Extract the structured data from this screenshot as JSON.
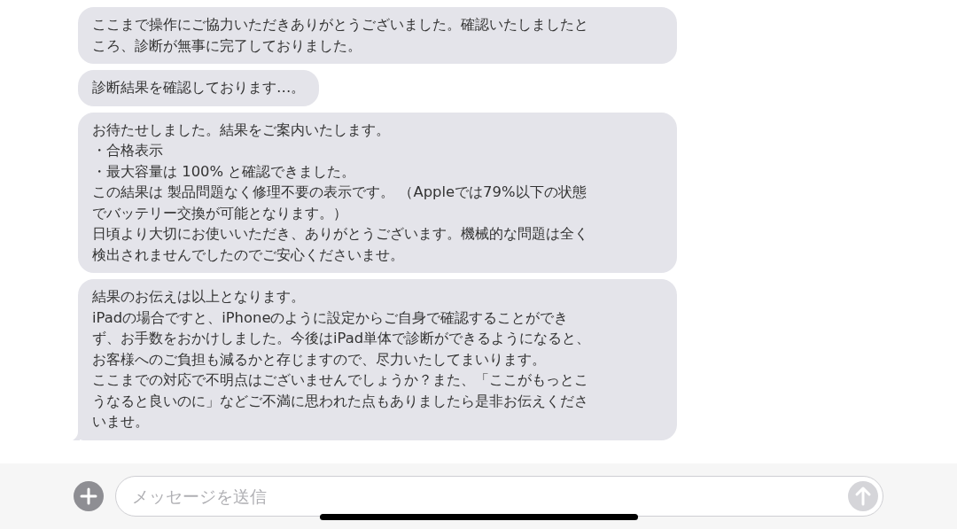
{
  "messages": [
    {
      "lines": [
        "ここまで操作にご協力いただきありがとうございました。確認いたしましたと",
        "ころ、診断が無事に完了しておりました。"
      ],
      "tail": false
    },
    {
      "lines": [
        "診断結果を確認しております…。"
      ],
      "tail": false
    },
    {
      "lines": [
        "お待たせしました。結果をご案内いたします。",
        "・合格表示",
        "・最大容量は 100% と確認できました。",
        "この結果は 製品問題なく修理不要の表示です。 （Appleでは79%以下の状態",
        "でバッテリー交換が可能となります。）",
        "日頃より大切にお使いいただき、ありがとうございます。機械的な問題は全く",
        "検出されませんでしたのでご安心くださいませ。"
      ],
      "tail": false
    },
    {
      "lines": [
        "結果のお伝えは以上となります。",
        "iPadの場合ですと、iPhoneのように設定からご自身で確認することができ",
        "ず、お手数をおかけしました。今後はiPad単体で診断ができるようになると、",
        "お客様へのご負担も減るかと存じますので、尽力いたしてまいります。",
        "ここまでの対応で不明点はございませんでしょうか？また、「ここがもっとこ",
        "うなると良いのに」などご不満に思われた点もありましたら是非お伝えくださ",
        "いませ。"
      ],
      "tail": true
    }
  ],
  "composer": {
    "placeholder": "メッセージを送信"
  }
}
